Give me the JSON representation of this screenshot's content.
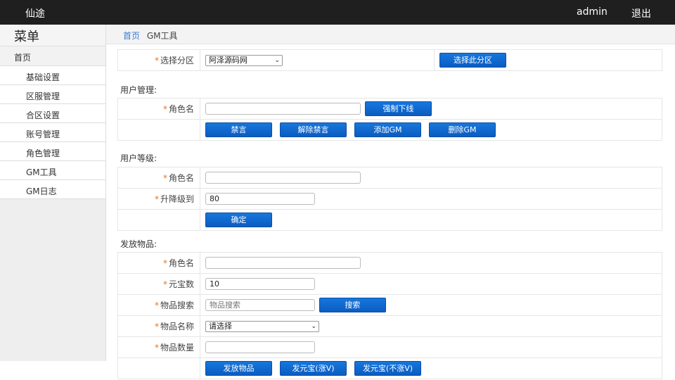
{
  "topbar": {
    "brand": "仙途",
    "user": "admin",
    "logout": "退出"
  },
  "sidebar": {
    "title": "菜单",
    "home": "首页",
    "items": [
      "基础设置",
      "区服管理",
      "合区设置",
      "账号管理",
      "角色管理",
      "GM工具",
      "GM日志"
    ]
  },
  "breadcrumb": {
    "home": "首页",
    "current": "GM工具"
  },
  "zone": {
    "label": "选择分区",
    "selected": "阿泽源码网",
    "button": "选择此分区"
  },
  "user_mgmt": {
    "title": "用户管理:",
    "role_label": "角色名",
    "kick_button": "强制下线",
    "buttons": [
      "禁言",
      "解除禁言",
      "添加GM",
      "删除GM"
    ]
  },
  "user_level": {
    "title": "用户等级:",
    "role_label": "角色名",
    "level_label": "升降级到",
    "level_value": "80",
    "confirm_button": "确定"
  },
  "items": {
    "title": "发放物品:",
    "role_label": "角色名",
    "gold_label": "元宝数",
    "gold_value": "10",
    "search_label": "物品搜索",
    "search_placeholder": "物品搜索",
    "search_button": "搜索",
    "name_label": "物品名称",
    "name_selected": "请选择",
    "qty_label": "物品数量",
    "buttons": [
      "发放物品",
      "发元宝(涨V)",
      "发元宝(不涨V)"
    ]
  }
}
